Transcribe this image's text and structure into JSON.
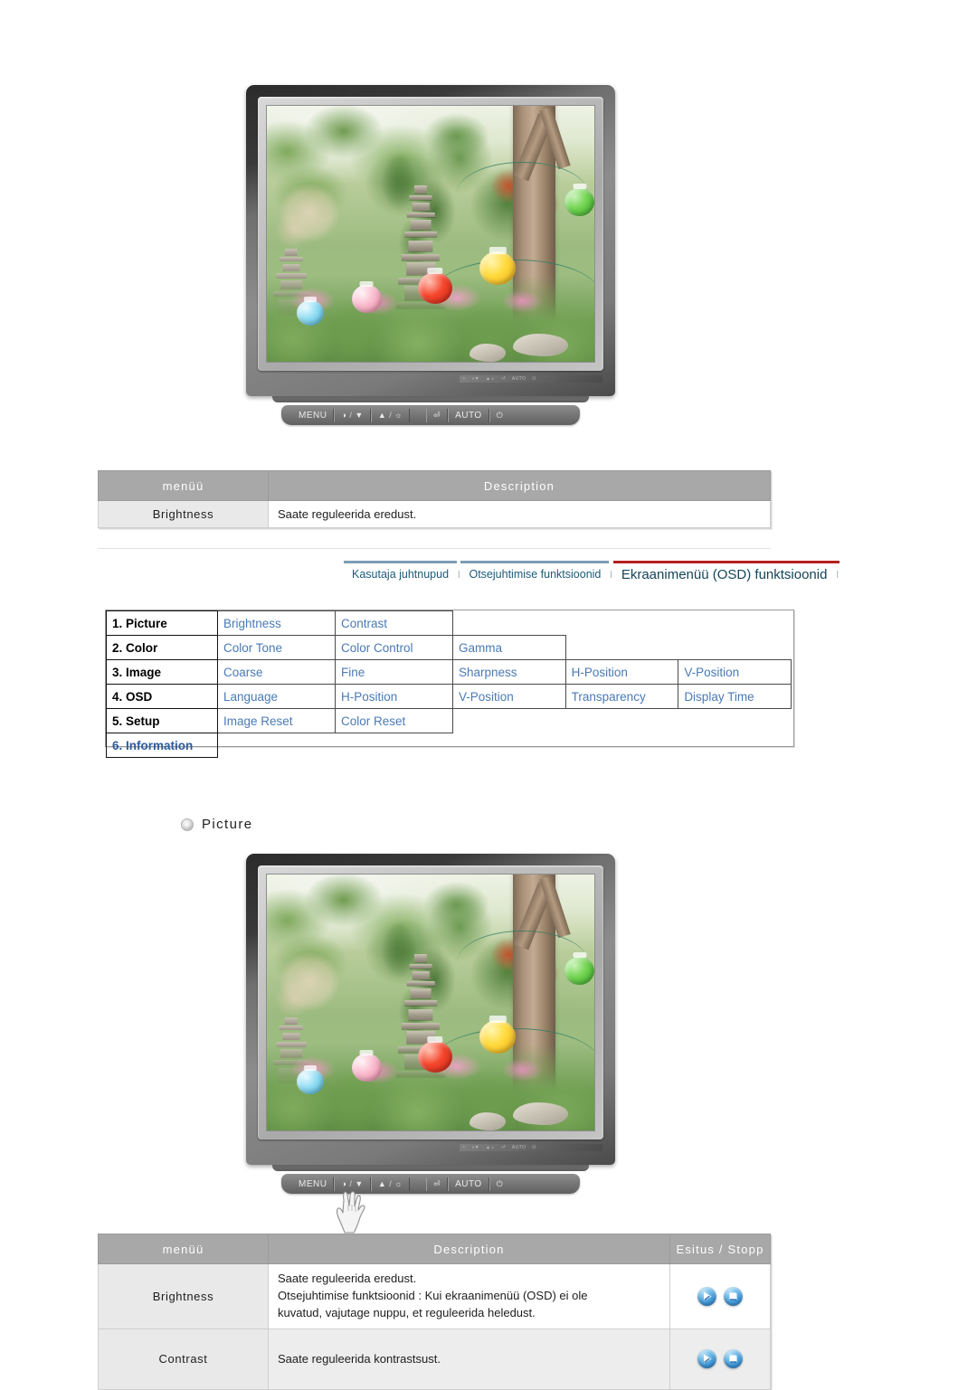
{
  "page": {
    "language_note": "Estonian monitor user manual page"
  },
  "monitor_top": {
    "name": "monitor-illustration-top",
    "controls": [
      {
        "label": "MENU",
        "icon": "",
        "name": "menu-button"
      },
      {
        "label": "",
        "icon": "contrast-down",
        "name": "contrast-down-button"
      },
      {
        "label": "",
        "icon": "up-brightness",
        "name": "brightness-up-button"
      },
      {
        "label": "",
        "icon": "enter",
        "name": "enter-button"
      },
      {
        "label": "AUTO",
        "icon": "",
        "name": "auto-button"
      },
      {
        "label": "",
        "icon": "power",
        "name": "power-button"
      }
    ]
  },
  "table_top": {
    "headers": [
      "menüü",
      "Description"
    ],
    "rows": [
      {
        "menu": "Brightness",
        "description": "Saate reguleerida eredust."
      }
    ]
  },
  "nav": {
    "tabs": [
      {
        "label": "Kasutaja juhtnupud",
        "active": false
      },
      {
        "label": "Otsejuhtimise funktsioonid",
        "active": false
      },
      {
        "label": "Ekraanimenüü (OSD) funktsioonid",
        "active": true
      }
    ],
    "divider": "l",
    "active_color": "#b3201e",
    "inactive_color": "#7d9db4",
    "link_color": "#1c5b78"
  },
  "osd_menu": {
    "link_color": "#4a7ab5",
    "rows": [
      {
        "category": "1. Picture",
        "category_is_link": false,
        "items": [
          "Brightness",
          "Contrast"
        ]
      },
      {
        "category": "2. Color",
        "category_is_link": false,
        "items": [
          "Color Tone",
          "Color Control",
          "Gamma"
        ]
      },
      {
        "category": "3. Image",
        "category_is_link": false,
        "items": [
          "Coarse",
          "Fine",
          "Sharpness",
          "H-Position",
          "V-Position"
        ]
      },
      {
        "category": "4. OSD",
        "category_is_link": false,
        "items": [
          "Language",
          "H-Position",
          "V-Position",
          "Transparency",
          "Display Time"
        ]
      },
      {
        "category": "5. Setup",
        "category_is_link": false,
        "items": [
          "Image Reset",
          "Color Reset"
        ]
      },
      {
        "category": "6. Information",
        "category_is_link": true,
        "items": []
      }
    ]
  },
  "section_heading": {
    "label": "Picture"
  },
  "monitor_bottom": {
    "name": "monitor-illustration-bottom",
    "cursor": "hand-pointer-on-menu-button",
    "controls": [
      {
        "label": "MENU",
        "icon": "",
        "name": "menu-button"
      },
      {
        "label": "",
        "icon": "contrast-down",
        "name": "contrast-down-button"
      },
      {
        "label": "",
        "icon": "up-brightness",
        "name": "brightness-up-button"
      },
      {
        "label": "",
        "icon": "enter",
        "name": "enter-button"
      },
      {
        "label": "AUTO",
        "icon": "",
        "name": "auto-button"
      },
      {
        "label": "",
        "icon": "power",
        "name": "power-button"
      }
    ]
  },
  "table_bottom": {
    "headers": [
      "menüü",
      "Description",
      "Esitus / Stopp"
    ],
    "rows": [
      {
        "menu": "Brightness",
        "description_lines": [
          "Saate reguleerida eredust.",
          "Otsejuhtimise funktsioonid : Kui ekraanimenüü (OSD) ei ole",
          "kuvatud, vajutage nuppu, et reguleerida heledust."
        ],
        "actions": [
          "play",
          "stop"
        ]
      },
      {
        "menu": "Contrast",
        "description_lines": [
          "Saate reguleerida kontrastsust."
        ],
        "actions": [
          "play",
          "stop"
        ]
      }
    ]
  }
}
